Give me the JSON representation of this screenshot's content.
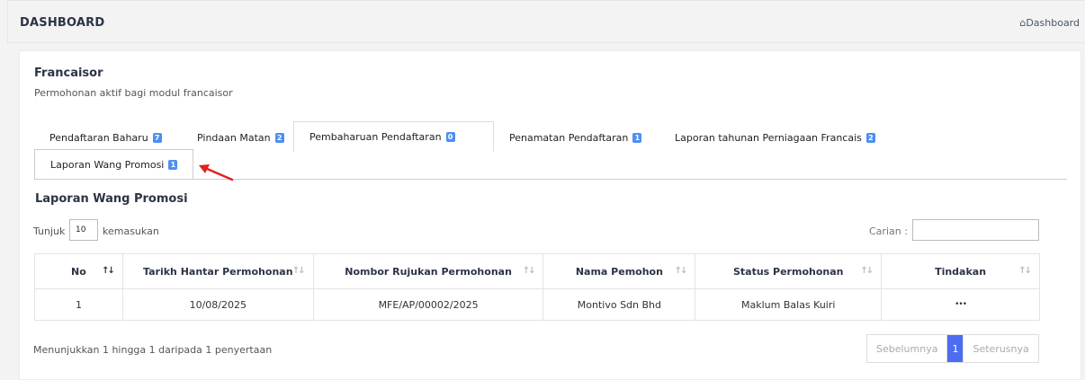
{
  "header": {
    "title": "DASHBOARD",
    "breadcrumb": "Dashboard"
  },
  "card": {
    "title": "Francaisor",
    "subtitle": "Permohonan aktif bagi modul francaisor"
  },
  "tabs": [
    {
      "label": "Pendaftaran Baharu",
      "count": "7"
    },
    {
      "label": "Pindaan Matan",
      "count": "2"
    },
    {
      "label": "Pembaharuan Pendaftaran",
      "count": "0"
    },
    {
      "label": "Penamatan Pendaftaran",
      "count": "1"
    },
    {
      "label": "Laporan tahunan Perniagaan Francais",
      "count": "2"
    },
    {
      "label": "Laporan Wang Promosi",
      "count": "1"
    }
  ],
  "section": {
    "title": "Laporan Wang Promosi",
    "show_label": "Tunjuk",
    "show_value": "10",
    "show_suffix": "kemasukan",
    "search_label": "Carian :",
    "search_value": ""
  },
  "table": {
    "headers": [
      "No",
      "Tarikh Hantar Permohonan",
      "Nombor Rujukan Permohonan",
      "Nama Pemohon",
      "Status Permohonan",
      "Tindakan"
    ],
    "rows": [
      [
        "1",
        "10/08/2025",
        "MFE/AP/00002/2025",
        "Montivo Sdn Bhd",
        "Maklum Balas Kuiri",
        "•••"
      ]
    ]
  },
  "footer": {
    "info": "Menunjukkan 1 hingga 1 daripada 1 penyertaan",
    "prev": "Sebelumnya",
    "page": "1",
    "next": "Seterusnya"
  },
  "colors": {
    "badge": "#4c8ff2",
    "annotation_arrow": "#e02020",
    "active_page": "#4c6df0"
  },
  "icons": {
    "breadcrumb": "home-icon",
    "sort": "sort-arrows-icon",
    "actions": "ellipsis-icon",
    "annotation": "red-arrow-icon"
  }
}
